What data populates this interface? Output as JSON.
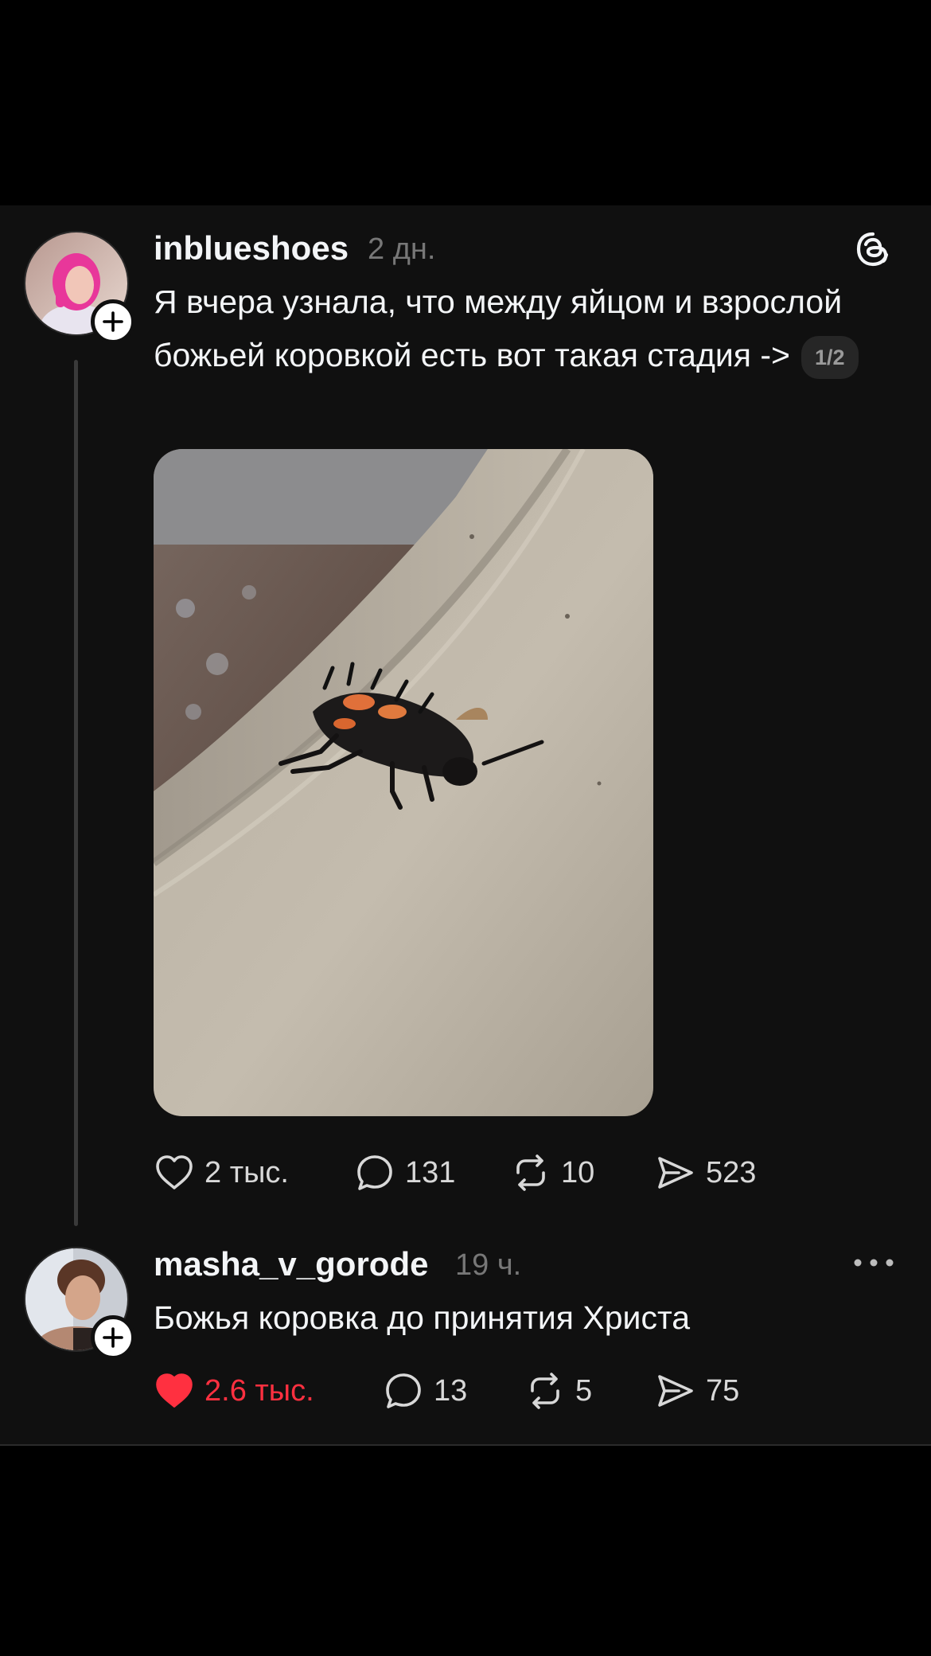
{
  "post": {
    "username": "inblueshoes",
    "time": "2 дн.",
    "text": "Я вчера узнала, что между яйцом и взрослой божьей коровкой есть вот такая стадия ->",
    "pager": "1/2",
    "actions": {
      "likes": "2 тыс.",
      "comments": "131",
      "reposts": "10",
      "shares": "523"
    }
  },
  "reply": {
    "username": "masha_v_gorode",
    "time": "19 ч.",
    "text": "Божья коровка до принятия Христа",
    "actions": {
      "likes": "2.6 тыс.",
      "comments": "13",
      "reposts": "5",
      "shares": "75"
    },
    "liked": true
  },
  "icons": [
    "threads-logo-icon",
    "plus-icon",
    "heart-icon",
    "comment-icon",
    "repost-icon",
    "share-icon",
    "more-icon"
  ],
  "colors": {
    "background": "#101010",
    "liked": "#ff3040",
    "text": "#f3f5f7",
    "secondary": "#777777"
  }
}
